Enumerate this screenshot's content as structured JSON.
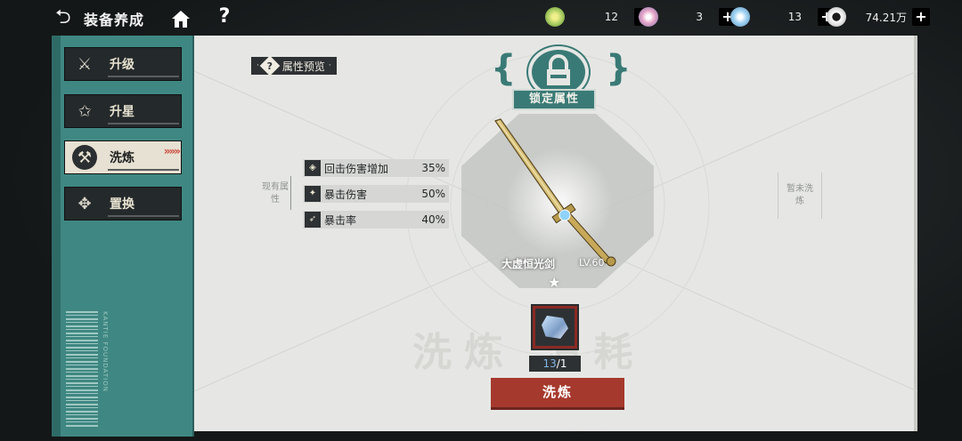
{
  "header": {
    "title": "装备养成",
    "back_icon": "back-arrow-icon",
    "home_icon": "home-icon",
    "help_label": "?"
  },
  "resources": [
    {
      "icon": "green-coin-icon",
      "value": "12",
      "plus": "+"
    },
    {
      "icon": "pink-orb-icon",
      "value": "3",
      "plus": "+"
    },
    {
      "icon": "blue-crystal-icon",
      "value": "13",
      "plus": "+"
    },
    {
      "icon": "silver-coin-icon",
      "value": "74.21万",
      "plus": "+"
    }
  ],
  "sidebar": {
    "items": [
      {
        "label": "升级",
        "icon": "crossed-swords-icon"
      },
      {
        "label": "升星",
        "icon": "star-icon"
      },
      {
        "label": "洗炼",
        "icon": "refine-hammer-icon",
        "active": true
      },
      {
        "label": "置换",
        "icon": "swap-icon"
      }
    ],
    "vertical_text": "KANTIE FOUNDATION"
  },
  "main": {
    "preview_label": "属性预览",
    "lock_label": "锁定属性",
    "current_attr_label": "现有属性",
    "future_attr_label": "暂未洗炼",
    "attributes": [
      {
        "name": "回击伤害增加",
        "value": "35%"
      },
      {
        "name": "暴击伤害",
        "value": "50%"
      },
      {
        "name": "暴击率",
        "value": "40%"
      }
    ],
    "item": {
      "name": "大虚恒光剑",
      "level": "LV.60"
    },
    "cost": {
      "owned": "13",
      "required": "/1"
    },
    "refine_button": "洗炼",
    "watermark": "洗炼 消耗"
  },
  "colors": {
    "accent_teal": "#3f8782",
    "button_red": "#a6392d"
  }
}
